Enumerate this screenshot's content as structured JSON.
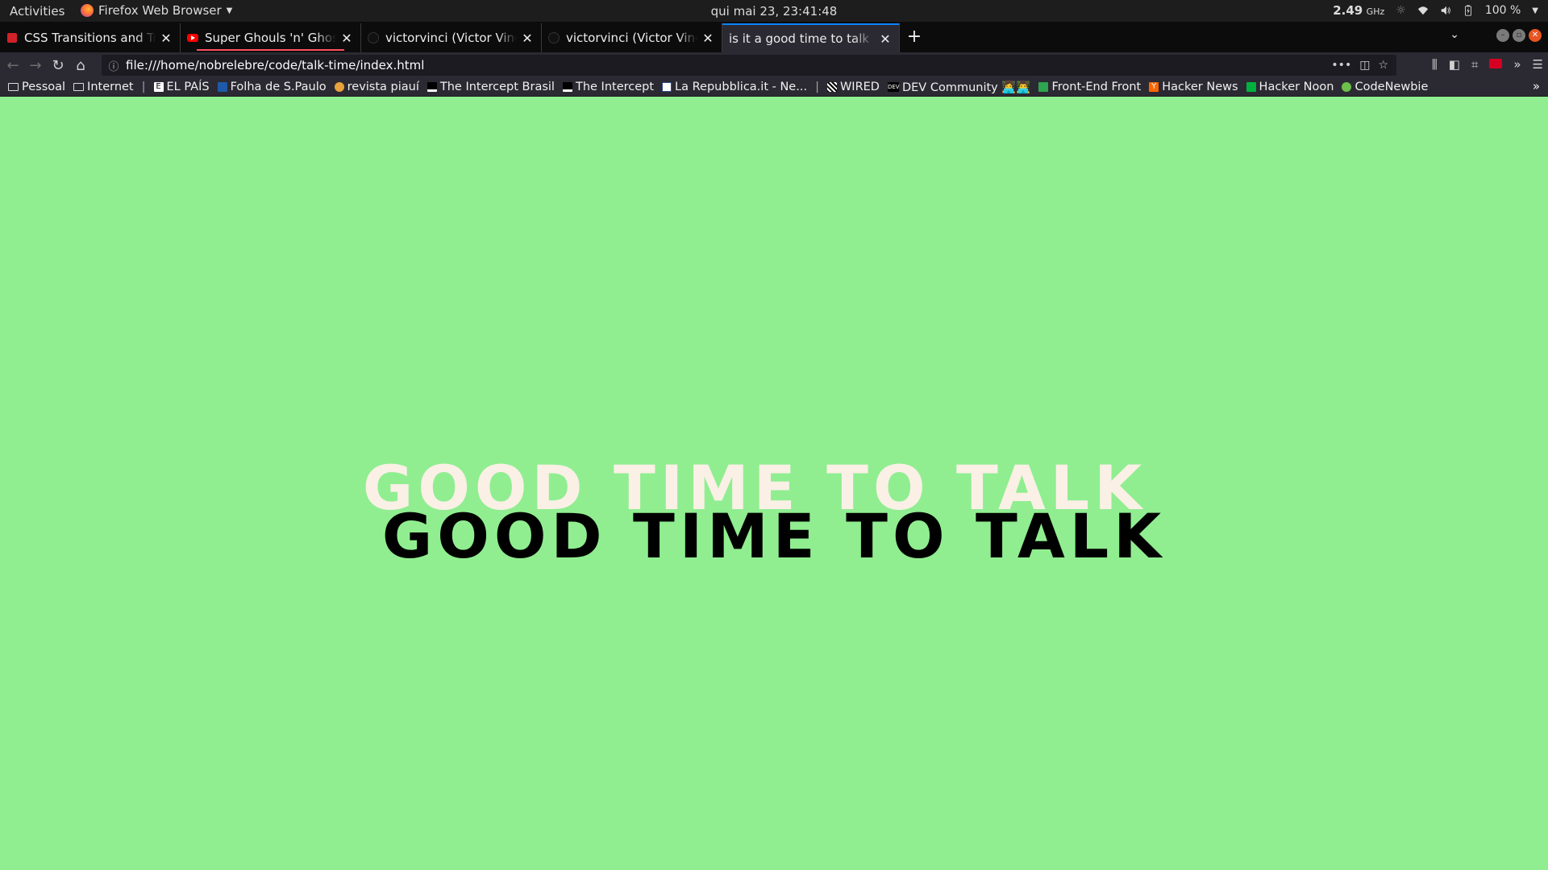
{
  "topbar": {
    "activities": "Activities",
    "app_name": "Firefox Web Browser",
    "clock": "qui mai 23, 23:41:48",
    "cpu_freq": "2.49",
    "cpu_unit": "GHz",
    "battery": "100 %"
  },
  "tabs": [
    {
      "title": "CSS Transitions and Transforms",
      "favicon": "treehouse-icon",
      "active": false
    },
    {
      "title": "Super Ghouls 'n' Ghosts",
      "favicon": "youtube-icon",
      "active": false,
      "playing": true
    },
    {
      "title": "victorvinci (Victor Vinci)",
      "favicon": "github-icon",
      "active": false
    },
    {
      "title": "victorvinci (Victor Vinci)",
      "favicon": "github-icon",
      "active": false
    },
    {
      "title": "is it a good time to talk to me",
      "favicon": "",
      "active": true
    }
  ],
  "navbar": {
    "url": "file:///home/nobrelebre/code/talk-time/index.html"
  },
  "bookmarks": [
    {
      "label": "Pessoal",
      "type": "folder"
    },
    {
      "label": "Internet",
      "type": "folder"
    },
    {
      "label": "EL PAÍS",
      "type": "link"
    },
    {
      "label": "Folha de S.Paulo",
      "type": "link"
    },
    {
      "label": "revista piauí",
      "type": "link"
    },
    {
      "label": "The Intercept Brasil",
      "type": "link"
    },
    {
      "label": "The Intercept",
      "type": "link"
    },
    {
      "label": "La Repubblica.it - Ne...",
      "type": "link"
    },
    {
      "label": "WIRED",
      "type": "link"
    },
    {
      "label": "DEV Community 👩‍💻👨‍💻",
      "type": "link"
    },
    {
      "label": "Front-End Front",
      "type": "link"
    },
    {
      "label": "Hacker News",
      "type": "link"
    },
    {
      "label": "Hacker Noon",
      "type": "link"
    },
    {
      "label": "CodeNewbie",
      "type": "link"
    }
  ],
  "page": {
    "background": "#90ee90",
    "headline_back": "GOOD TIME TO TALK",
    "headline_front": "GOOD TIME TO TALK",
    "headline_back_color": "#faf0e6",
    "headline_front_color": "#000000"
  }
}
